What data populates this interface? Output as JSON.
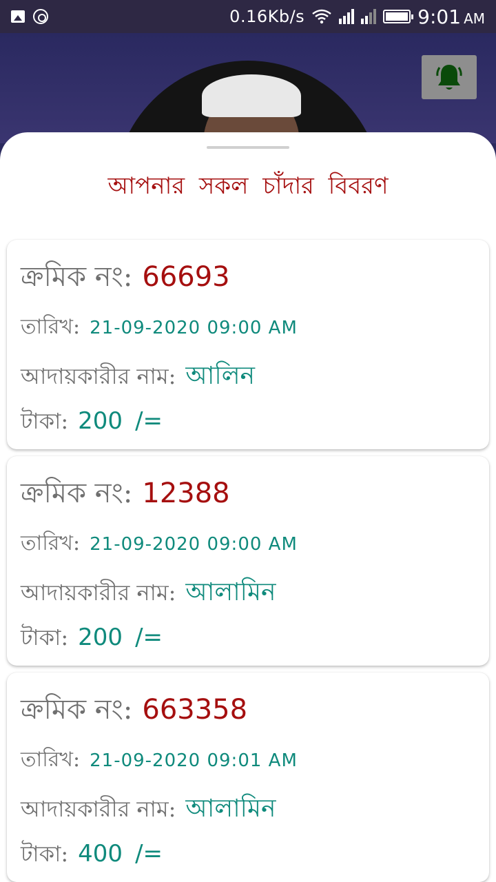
{
  "status_bar": {
    "speed": "0.16Kb/s",
    "time": "9:01",
    "ampm": "AM",
    "sim1": "1",
    "sim2": "2"
  },
  "header": {
    "avatar_icon": "profile-photo",
    "bell_icon": "notification-bell-icon",
    "bell_color": "#0a4a0a"
  },
  "sheet": {
    "title": "আপনার সকল চাঁদার বিবরণ"
  },
  "labels": {
    "serial": "ক্রমিক নং:",
    "date": "তারিখ:",
    "collector": "আদায়কারীর নাম:",
    "amount": "টাকা:",
    "amount_suffix": "/="
  },
  "records": [
    {
      "serial": "66693",
      "date": "21-09-2020 09:00 AM",
      "collector": "আলিন",
      "amount": "200"
    },
    {
      "serial": "12388",
      "date": "21-09-2020 09:00 AM",
      "collector": "আলামিন",
      "amount": "200"
    },
    {
      "serial": "663358",
      "date": "21-09-2020 09:01 AM",
      "collector": "আলামিন",
      "amount": "400"
    }
  ],
  "colors": {
    "accent_red": "#a50f0f",
    "accent_teal": "#0f8a7c",
    "header_bg": "#2b2a5e"
  }
}
